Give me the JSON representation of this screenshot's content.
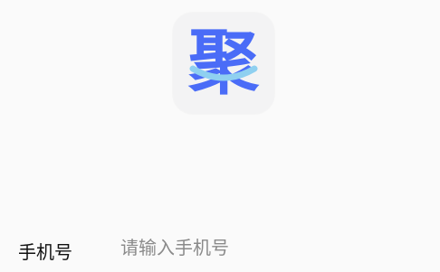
{
  "logo": {
    "glyph": "聚",
    "icon": "app-logo-icon",
    "color": "#4a6cf7",
    "accent_color": "#8fd0f0",
    "tile_color": "#f3f3f4"
  },
  "login_form": {
    "phone_label": "手机号",
    "phone_placeholder": "请输入手机号",
    "phone_value": ""
  }
}
